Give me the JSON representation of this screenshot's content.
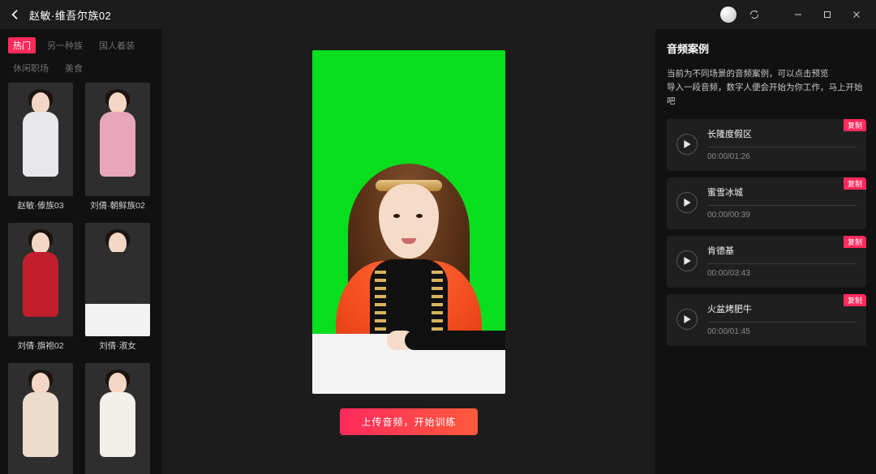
{
  "titlebar": {
    "title": "赵敏·维吾尔族02"
  },
  "left": {
    "tabs": [
      {
        "label": "热门",
        "active": true
      },
      {
        "label": "另一种族",
        "active": false
      },
      {
        "label": "国人着装",
        "active": false
      },
      {
        "label": "休闲职场",
        "active": false
      },
      {
        "label": "美食",
        "active": false
      }
    ],
    "characters": [
      {
        "name": "赵敏·傣族03",
        "body": "#e8e8ea",
        "desk": false
      },
      {
        "name": "刘倩·朝鲜族02",
        "body": "#e7a6b9",
        "desk": false
      },
      {
        "name": "刘倩·旗袍02",
        "body": "#c21f2e",
        "desk": false
      },
      {
        "name": "刘倩·淑女",
        "body": "#2d2d2d",
        "desk": true
      },
      {
        "name": "",
        "body": "#ecdccb",
        "desk": false
      },
      {
        "name": "",
        "body": "#f2f0ea",
        "desk": false
      }
    ]
  },
  "center": {
    "cta_label": "上传音频，开始训练"
  },
  "right": {
    "heading": "音频案例",
    "description": "当前为不同场景的音频案例，可以点击预览\n导入一段音频，数字人便会开始为你工作，马上开始吧",
    "badge_label": "复制",
    "audios": [
      {
        "title": "长隆度假区",
        "duration": "00:00/01:26"
      },
      {
        "title": "蜜雪冰城",
        "duration": "00:00/00:39"
      },
      {
        "title": "肯德基",
        "duration": "00:00/03:43"
      },
      {
        "title": "火盆烤肥牛",
        "duration": "00:00/01:45"
      }
    ]
  }
}
